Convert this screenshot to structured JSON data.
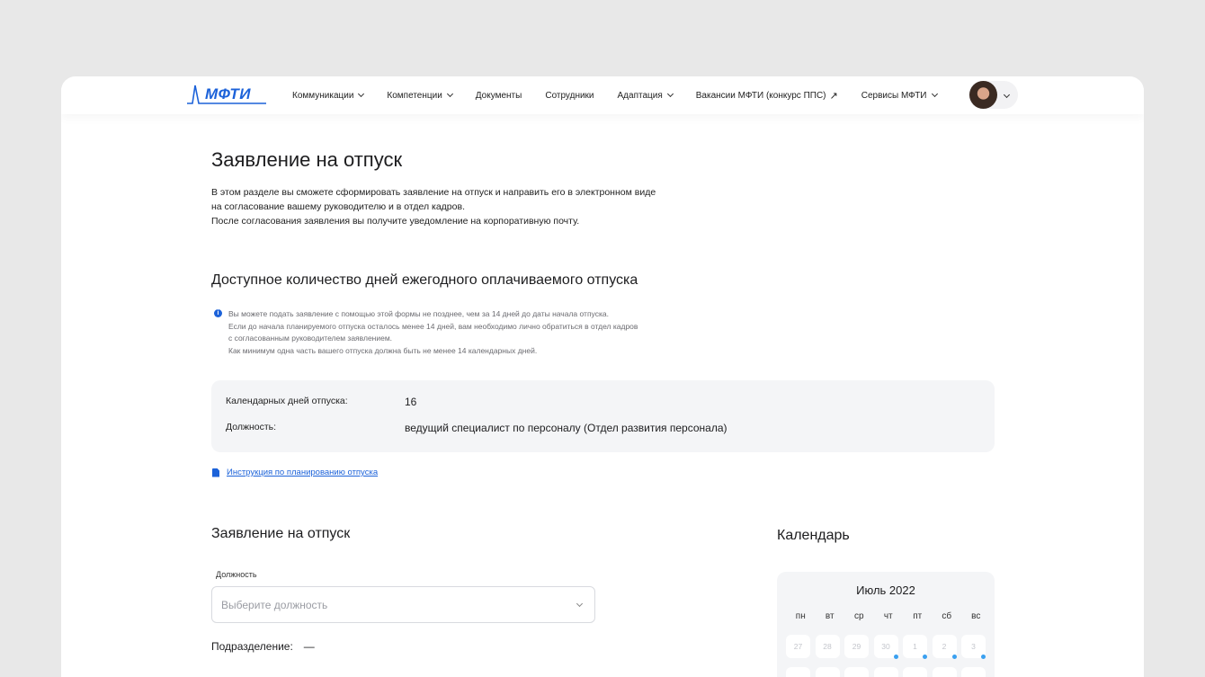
{
  "header": {
    "logo_text": "МФТИ",
    "nav": [
      {
        "label": "Коммуникации",
        "dropdown": true
      },
      {
        "label": "Компетенции",
        "dropdown": true
      },
      {
        "label": "Документы",
        "dropdown": false
      },
      {
        "label": "Сотрудники",
        "dropdown": false
      },
      {
        "label": "Адаптация",
        "dropdown": true
      },
      {
        "label": "Вакансии МФТИ (конкурс ППС)",
        "dropdown": false,
        "external": true
      },
      {
        "label": "Сервисы МФТИ",
        "dropdown": true
      }
    ]
  },
  "page": {
    "title": "Заявление на отпуск",
    "intro": [
      "В этом разделе вы сможете сформировать заявление на отпуск и направить его в электронном виде",
      "на согласование вашему руководителю и в отдел кадров.",
      "После согласования заявления вы получите уведомление на корпоративную почту."
    ]
  },
  "available": {
    "heading": "Доступное количество дней ежегодного оплачиваемого отпуска",
    "info_icon": "i",
    "notice": [
      "Вы можете подать заявление с помощью этой формы не позднее, чем за 14 дней до даты начала отпуска.",
      "Если до начала планируемого отпуска осталось менее 14 дней, вам необходимо лично обратиться в отдел кадров",
      "с согласованным руководителем заявлением.",
      "Как минимум одна часть вашего отпуска должна быть не менее 14 календарных дней."
    ],
    "days_label": "Календарных дней отпуска:",
    "days_value": "16",
    "position_label": "Должность:",
    "position_value": "ведущий специалист по персоналу (Отдел развития персонала)",
    "instruction_link": "Инструкция по планированию отпуска"
  },
  "form": {
    "heading": "Заявление на отпуск",
    "position_field_label": "Должность",
    "position_placeholder": "Выберите должность",
    "department_label": "Подразделение:",
    "department_value": "—"
  },
  "calendar": {
    "heading": "Календарь",
    "month": "Июль 2022",
    "weekdays": [
      "пн",
      "вт",
      "ср",
      "чт",
      "пт",
      "сб",
      "вс"
    ],
    "first_week": [
      {
        "day": "27",
        "marked": false
      },
      {
        "day": "28",
        "marked": false
      },
      {
        "day": "29",
        "marked": false
      },
      {
        "day": "30",
        "marked": true
      },
      {
        "day": "1",
        "marked": true
      },
      {
        "day": "2",
        "marked": true
      },
      {
        "day": "3",
        "marked": true
      }
    ]
  },
  "colors": {
    "accent": "#1c62d9",
    "marker": "#3aa0f0",
    "panel": "#f4f5f7"
  }
}
